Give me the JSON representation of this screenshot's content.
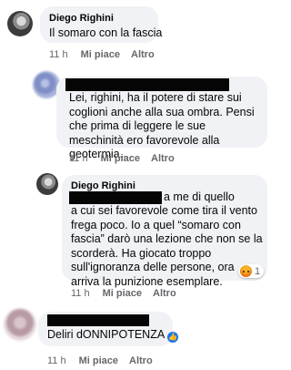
{
  "comments": [
    {
      "author": "Diego Righini",
      "text": "Il somaro con la fascia",
      "time": "11 h",
      "like_label": "Mi piace",
      "reply_label": "Altro"
    },
    {
      "author": "",
      "text": "Lei, righini, ha il potere di stare sui coglioni anche alla sua ombra. Pensi che prima di leggere le sue meschinità ero favorevole alla geotermia....",
      "time": "11 h",
      "like_label": "Mi piace",
      "reply_label": "Altro"
    },
    {
      "author": "Diego Righini",
      "line1_suffix": "a me di quello",
      "text_rest": "a cui sei favorevole come tira il vento frega poco. Io a quel “somaro con fascia” darò una lezione che non se la scorderà. Ha giocato troppo sull'ignoranza delle persone, ora arriva la punizione esemplare.",
      "time": "11 h",
      "like_label": "Mi piace",
      "reply_label": "Altro",
      "reaction_count": "1",
      "reaction_icon": "angry-reaction-icon"
    },
    {
      "author": "",
      "text": "Deliri dONNIPOTENZA",
      "verified_icon": "like-thumb-icon",
      "time": "11 h",
      "like_label": "Mi piace",
      "reply_label": "Altro"
    }
  ],
  "colors": {
    "bubble": "#f0f2f5",
    "meta": "#65676b",
    "text": "#050505",
    "redaction": "#050505"
  }
}
